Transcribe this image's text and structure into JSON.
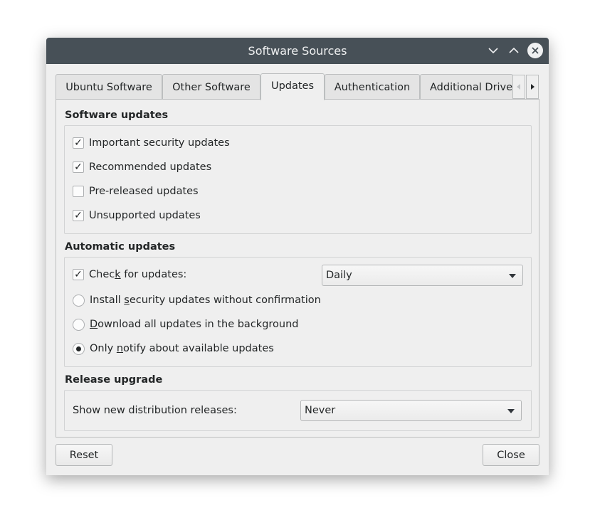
{
  "window": {
    "title": "Software Sources",
    "controls": {
      "minimize_icon": "chevron-down-icon",
      "maximize_icon": "chevron-up-icon",
      "close_icon": "close-icon"
    }
  },
  "tabs": [
    {
      "label": "Ubuntu Software",
      "active": false
    },
    {
      "label": "Other Software",
      "active": false
    },
    {
      "label": "Updates",
      "active": true
    },
    {
      "label": "Authentication",
      "active": false
    },
    {
      "label": "Additional Drivers",
      "active": false
    }
  ],
  "software_updates": {
    "title": "Software updates",
    "items": [
      {
        "label": "Important security updates",
        "checked": true
      },
      {
        "label": "Recommended updates",
        "checked": true
      },
      {
        "label": "Pre-released updates",
        "checked": false
      },
      {
        "label": "Unsupported updates",
        "checked": true
      }
    ]
  },
  "automatic_updates": {
    "title": "Automatic updates",
    "check": {
      "label_pre": "Chec",
      "label_mnemonic": "k",
      "label_post": " for updates:",
      "checked": true,
      "frequency": "Daily"
    },
    "options": [
      {
        "pre": "Install ",
        "mnemonic": "s",
        "post": "ecurity updates without confirmation",
        "selected": false
      },
      {
        "pre": "",
        "mnemonic": "D",
        "post": "ownload all updates in the background",
        "selected": false
      },
      {
        "pre": "Only ",
        "mnemonic": "n",
        "post": "otify about available updates",
        "selected": true
      }
    ]
  },
  "release_upgrade": {
    "title": "Release upgrade",
    "label": "Show new distribution releases:",
    "value": "Never"
  },
  "buttons": {
    "reset": "Reset",
    "close": "Close"
  }
}
